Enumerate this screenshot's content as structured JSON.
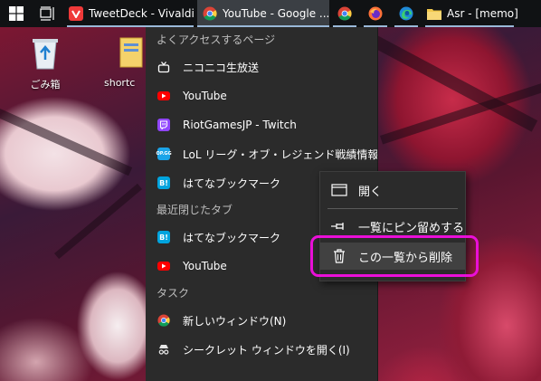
{
  "taskbar": {
    "windows": [
      {
        "label": "TweetDeck - Vivaldi",
        "icon": "vivaldi-icon",
        "color": "#ef3939"
      },
      {
        "label": "YouTube - Google ...",
        "icon": "chrome-icon",
        "color": "#4285f4"
      },
      {
        "label": "",
        "icon": "chrome-icon"
      },
      {
        "label": "",
        "icon": "firefox-icon"
      },
      {
        "label": "",
        "icon": "edge-icon"
      },
      {
        "label": "Asr - [memo]",
        "icon": "folder-icon",
        "color": "#f2c94c"
      }
    ]
  },
  "desktop": {
    "icons": [
      {
        "label": "ごみ箱",
        "icon": "recycle-bin-icon"
      },
      {
        "label": "shortc",
        "icon": "shortcut-icon"
      }
    ]
  },
  "jumplist": {
    "frequent_header": "よくアクセスするページ",
    "frequent": [
      {
        "label": "ニコニコ生放送",
        "icon": "niconico-icon"
      },
      {
        "label": "YouTube",
        "icon": "youtube-icon"
      },
      {
        "label": "RiotGamesJP - Twitch",
        "icon": "twitch-icon"
      },
      {
        "label": "LoL リーグ・オブ・レジェンド戦績情報、データ...",
        "icon": "opgg-icon",
        "icon_text": "OP.GG"
      },
      {
        "label": "はてなブックマーク",
        "icon": "hatena-icon",
        "icon_text": "B!"
      }
    ],
    "recent_header": "最近閉じたタブ",
    "recent": [
      {
        "label": "はてなブックマーク",
        "icon": "hatena-icon",
        "icon_text": "B!"
      },
      {
        "label": "YouTube",
        "icon": "youtube-icon"
      }
    ],
    "tasks_header": "タスク",
    "tasks": [
      {
        "label": "新しいウィンドウ(N)",
        "icon": "chrome-icon"
      },
      {
        "label": "シークレット ウィンドウを開く(I)",
        "icon": "incognito-icon"
      }
    ]
  },
  "context_menu": {
    "open": "開く",
    "pin": "一覧にピン留めする",
    "remove": "この一覧から削除"
  },
  "colors": {
    "highlight": "#ea0fd8",
    "youtube": "#ff0000",
    "twitch": "#9146ff",
    "hatena": "#00a4de",
    "opgg": "#1ba4e8"
  }
}
